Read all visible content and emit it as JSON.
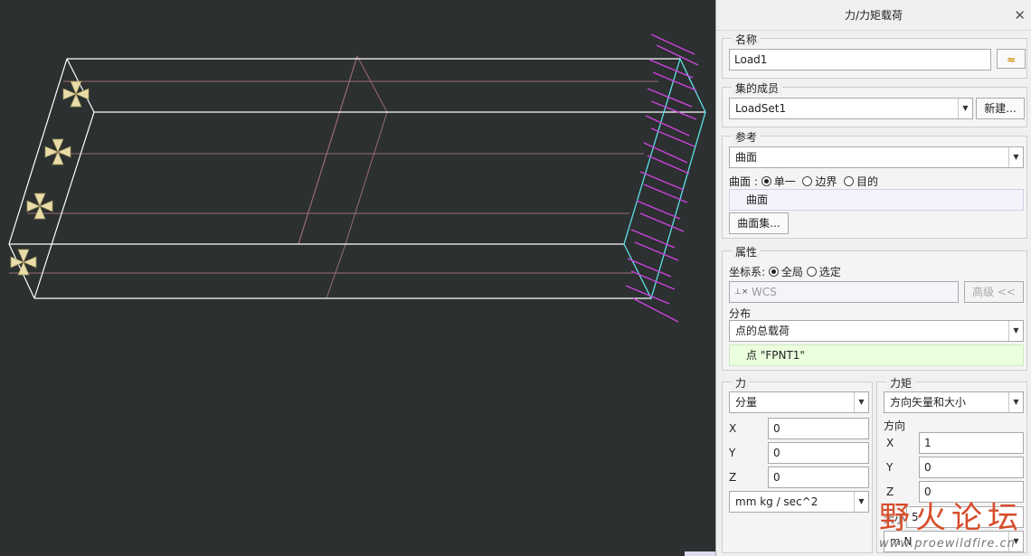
{
  "panel": {
    "title": "力/力矩载荷",
    "close_icon": "close-icon",
    "name_group": {
      "title": "名称",
      "value": "Load1"
    },
    "set_group": {
      "title": "集的成员",
      "selected": "LoadSet1",
      "new_button": "新建..."
    },
    "reference_group": {
      "title": "参考",
      "selected": "曲面",
      "radio_label": "曲面 :",
      "radios": [
        {
          "label": "单一",
          "checked": true
        },
        {
          "label": "边界",
          "checked": false
        },
        {
          "label": "目的",
          "checked": false
        }
      ],
      "collector": "曲面",
      "surface_set_button": "曲面集..."
    },
    "properties_group": {
      "title": "属性",
      "csys_label": "坐标系:",
      "csys_radios": [
        {
          "label": "全局",
          "checked": true
        },
        {
          "label": "选定",
          "checked": false
        }
      ],
      "csys_value": "WCS",
      "advanced_button": "高级 <<",
      "distribution_label": "分布",
      "distribution_selected": "点的总载荷",
      "point_collector": "点 \"FPNT1\""
    },
    "force_group": {
      "title": "力",
      "mode": "分量",
      "x_label": "X",
      "x": "0",
      "y_label": "Y",
      "y": "0",
      "z_label": "Z",
      "z": "0",
      "units": "mm kg / sec^2"
    },
    "moment_group": {
      "title": "力矩",
      "mode": "方向矢量和大小",
      "direction_label": "方向",
      "x_label": "X",
      "x": "1",
      "y_label": "Y",
      "y": "0",
      "z_label": "Z",
      "z": "0",
      "magnitude_label": "大小",
      "magnitude": "5",
      "units": "m N"
    }
  },
  "watermark": {
    "text": "野火论坛",
    "url": "www.proewildfire.cn"
  },
  "colors": {
    "viewport_bg": "#2c3030",
    "arrows": "#cc44dd",
    "constraints": "#e8dca8",
    "edges": "#ffffff",
    "selected_surface": "#5ee0e8"
  }
}
